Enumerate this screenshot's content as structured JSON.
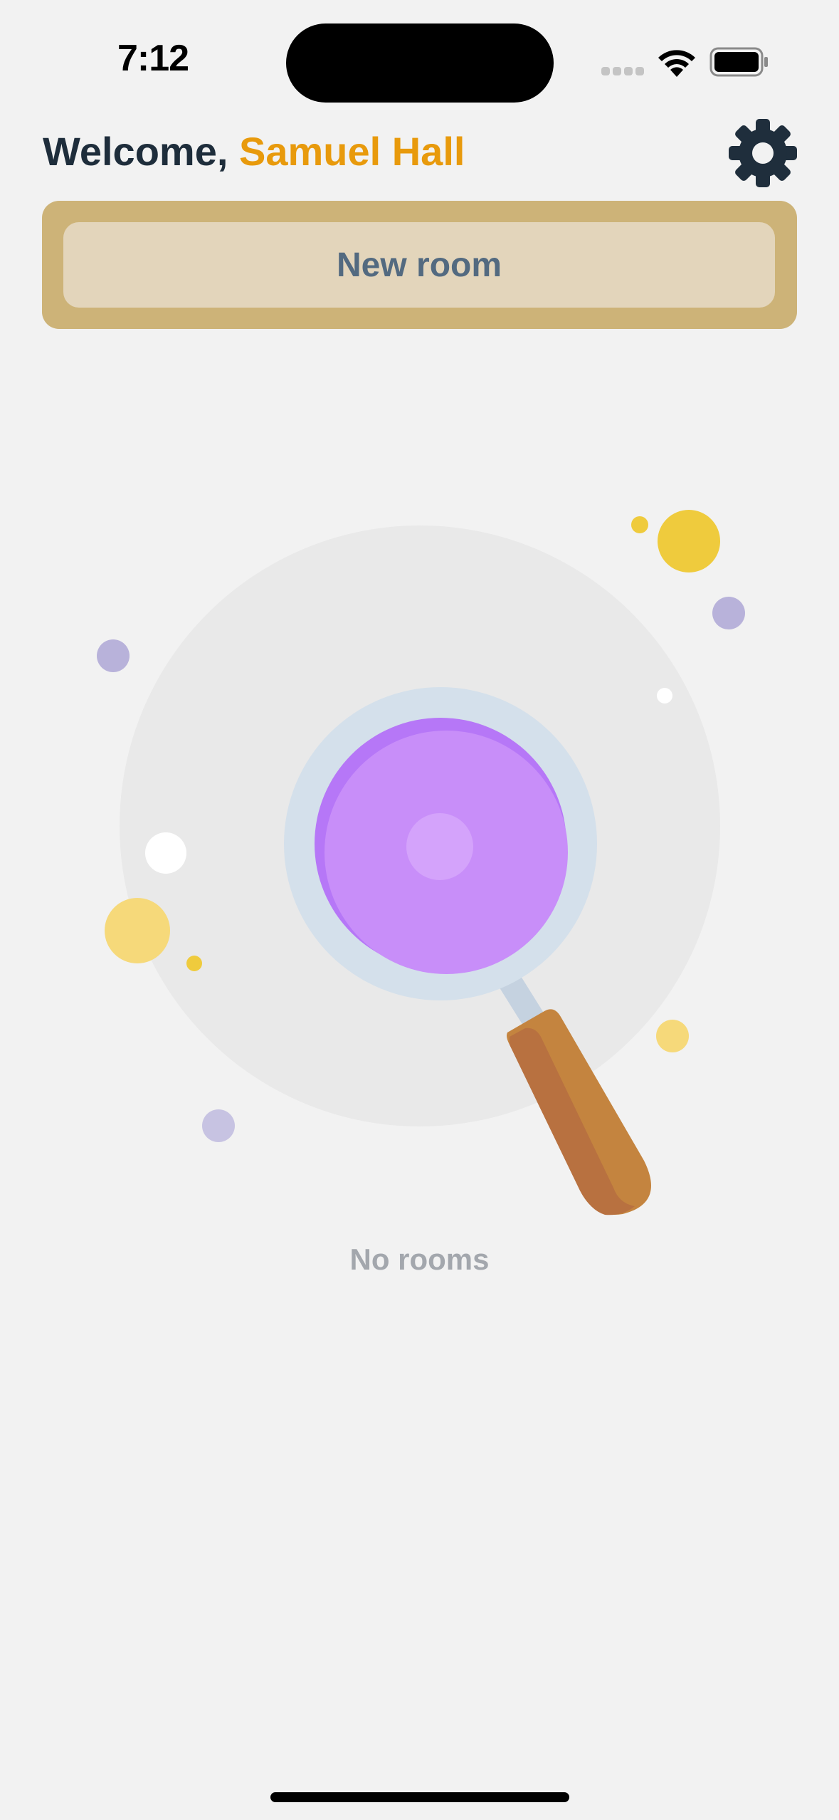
{
  "status_bar": {
    "time": "7:12"
  },
  "header": {
    "greeting": "Welcome,",
    "user_name": "Samuel Hall",
    "settings_icon": "gear-icon"
  },
  "actions": {
    "new_room_label": "New room"
  },
  "empty_state": {
    "message": "No rooms",
    "illustration": "magnifying-glass-illustration"
  },
  "colors": {
    "background": "#f2f2f2",
    "greeting_text": "#1e2d3b",
    "user_name": "#e89a0c",
    "card": "#cdb378",
    "button_fill": "#e3d5bb",
    "button_text": "#536a80",
    "empty_text": "#a3a7ad"
  }
}
